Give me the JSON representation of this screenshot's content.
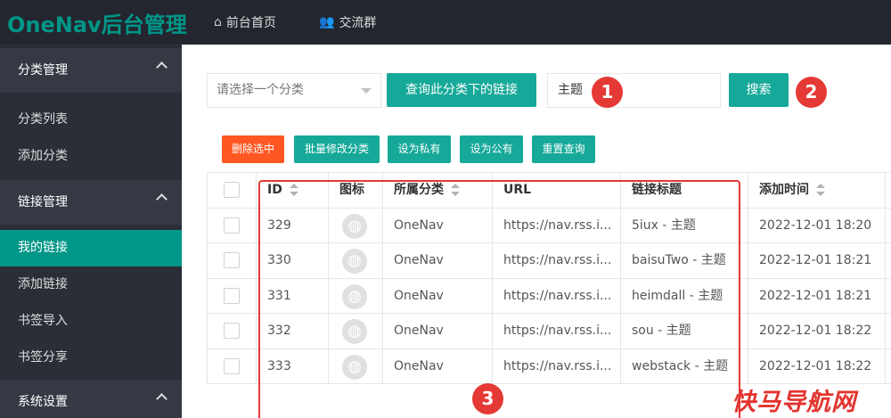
{
  "header": {
    "logo": "OneNav后台管理",
    "nav": [
      {
        "icon": "home-icon",
        "glyph": "⌂",
        "label": "前台首页"
      },
      {
        "icon": "users-icon",
        "glyph": "👥",
        "label": "交流群"
      }
    ]
  },
  "sidebar": {
    "groups": [
      {
        "title": "分类管理",
        "items": [
          "分类列表",
          "添加分类"
        ]
      },
      {
        "title": "链接管理",
        "items": [
          "我的链接",
          "添加链接",
          "书签导入",
          "书签分享"
        ]
      },
      {
        "title": "系统设置",
        "items": []
      }
    ],
    "active_item": "我的链接"
  },
  "toolbar": {
    "category_placeholder": "请选择一个分类",
    "query_button": "查询此分类下的链接",
    "search_value": "主题",
    "search_button": "搜索"
  },
  "badges": [
    "1",
    "2",
    "3"
  ],
  "actions": {
    "delete": "删除选中",
    "batch_category": "批量修改分类",
    "set_private": "设为私有",
    "set_public": "设为公有",
    "reset_query": "重置查询"
  },
  "table": {
    "columns": [
      "ID",
      "图标",
      "所属分类",
      "URL",
      "链接标题",
      "添加时间"
    ],
    "rows": [
      {
        "id": "329",
        "category": "OneNav",
        "url": "https://nav.rss.i...",
        "title": "5iux - 主题",
        "time": "2022-12-01 18:20"
      },
      {
        "id": "330",
        "category": "OneNav",
        "url": "https://nav.rss.i...",
        "title": "baisuTwo - 主题",
        "time": "2022-12-01 18:21"
      },
      {
        "id": "331",
        "category": "OneNav",
        "url": "https://nav.rss.i...",
        "title": "heimdall - 主题",
        "time": "2022-12-01 18:21"
      },
      {
        "id": "332",
        "category": "OneNav",
        "url": "https://nav.rss.i...",
        "title": "sou - 主题",
        "time": "2022-12-01 18:22"
      },
      {
        "id": "333",
        "category": "OneNav",
        "url": "https://nav.rss.i...",
        "title": "webstack - 主题",
        "time": "2022-12-01 18:22"
      }
    ]
  },
  "watermark": "快马导航网",
  "colors": {
    "accent": "#16a999",
    "danger": "#ff5722",
    "annotation": "#e53935",
    "header_bg": "#23262e",
    "sidebar_bg": "#2b2e37"
  }
}
